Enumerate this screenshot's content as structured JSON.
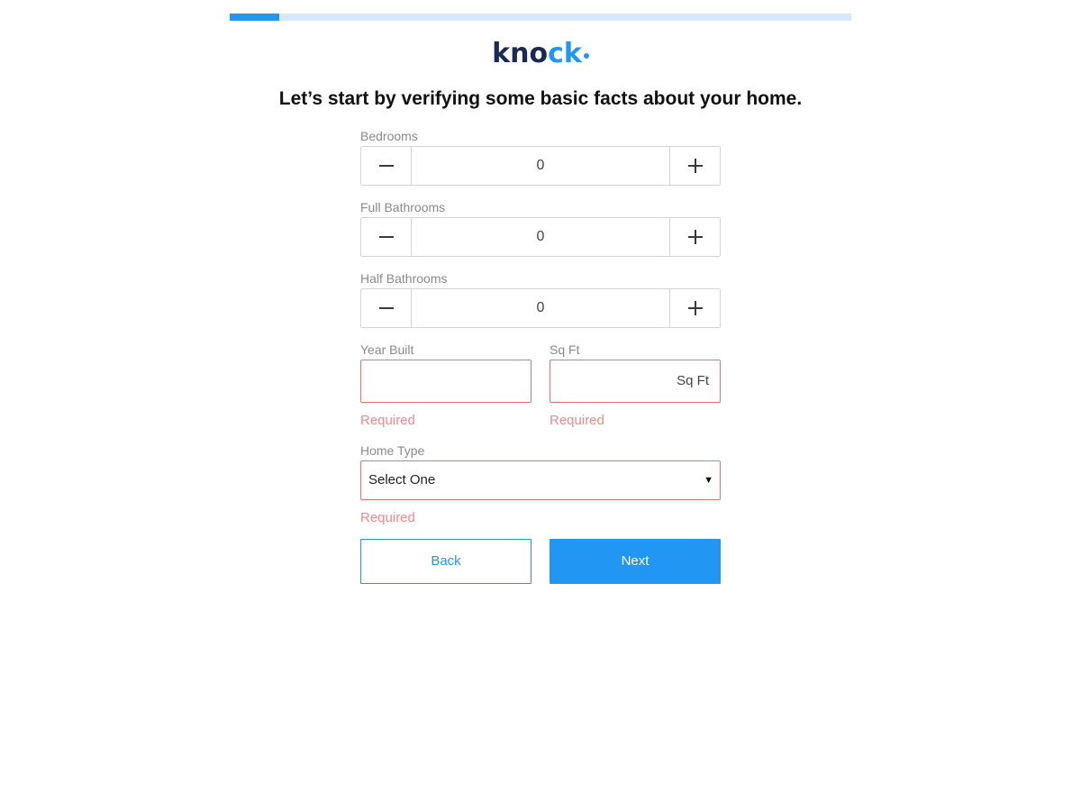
{
  "progress": {
    "fraction": 0.08
  },
  "logo": {
    "text_main": "kno",
    "text_accent": "ck"
  },
  "headline": "Let’s start by verifying some basic facts about your home.",
  "form": {
    "bedrooms": {
      "label": "Bedrooms",
      "value": "0"
    },
    "full_bathrooms": {
      "label": "Full Bathrooms",
      "value": "0"
    },
    "half_bathrooms": {
      "label": "Half Bathrooms",
      "value": "0"
    },
    "year_built": {
      "label": "Year Built",
      "value": "",
      "error": "Required"
    },
    "sq_ft": {
      "label": "Sq Ft",
      "value": "",
      "suffix": "Sq Ft",
      "error": "Required"
    },
    "home_type": {
      "label": "Home Type",
      "selected": "Select One",
      "error": "Required"
    }
  },
  "buttons": {
    "back_label": "Back",
    "next_label": "Next"
  },
  "colors": {
    "accent": "#2196f3",
    "progress_track": "#d6e8fb",
    "error": "#ef8a8a",
    "error_border": "#e57373",
    "logo_navy": "#1a2a55"
  },
  "icons": {
    "minus": "minus-icon",
    "plus": "plus-icon",
    "caret": "caret-down-icon"
  }
}
